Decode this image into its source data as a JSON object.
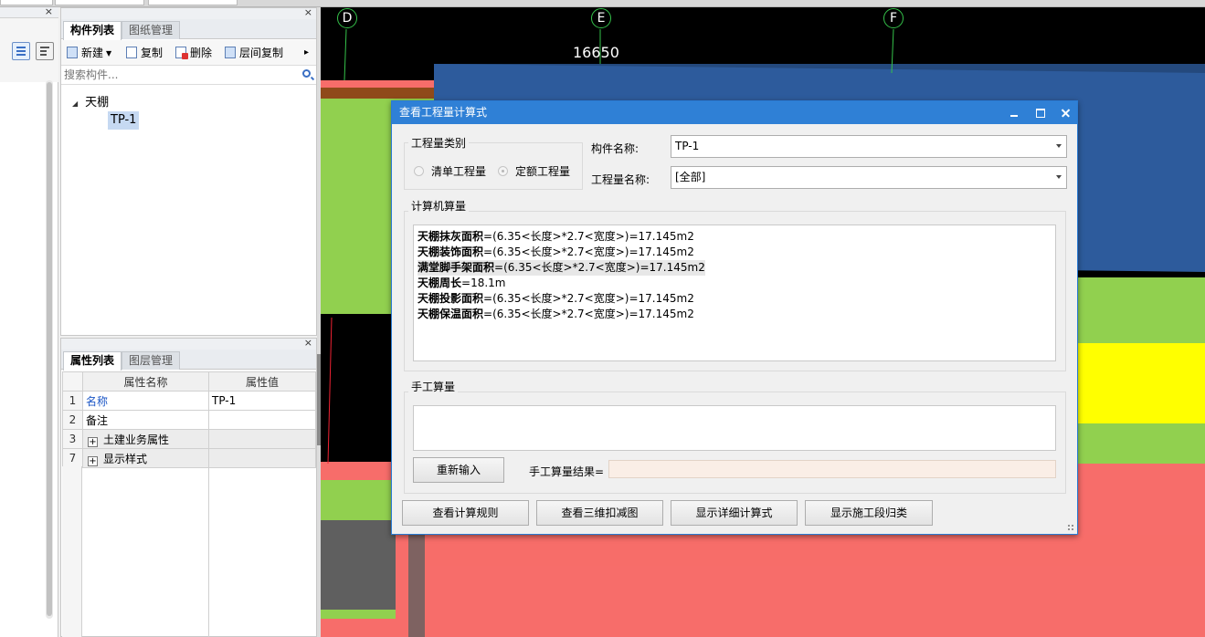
{
  "component_panel": {
    "tabs": [
      "构件列表",
      "图纸管理"
    ],
    "toolbar": {
      "new": "新建",
      "copy": "复制",
      "delete": "删除",
      "floor_copy": "层间复制",
      "more": "▸"
    },
    "search_placeholder": "搜索构件...",
    "tree": {
      "root": "天棚",
      "selected": "TP-1"
    },
    "close": "×"
  },
  "property_panel": {
    "tabs": [
      "属性列表",
      "图层管理"
    ],
    "columns": [
      "属性名称",
      "属性值"
    ],
    "rows": [
      {
        "num": "1",
        "name": "名称",
        "value": "TP-1"
      },
      {
        "num": "2",
        "name": "备注",
        "value": ""
      },
      {
        "num": "3",
        "name": "土建业务属性",
        "value": "",
        "expand": "+"
      },
      {
        "num": "7",
        "name": "显示样式",
        "value": "",
        "expand": "+"
      }
    ],
    "close": "×"
  },
  "left_panel": {
    "close": "×"
  },
  "canvas": {
    "axes": [
      "D",
      "E",
      "F"
    ],
    "dimension": "16650",
    "colors": {
      "background": "#000000",
      "green": "#91d04f",
      "blue": "#2d5b9c",
      "yellow": "#ffff00",
      "red": "#f76d6a",
      "gray": "#5f5f5f",
      "brown": "#8f4a1a"
    }
  },
  "dialog": {
    "title": "查看工程量计算式",
    "controls": {
      "minimize": "",
      "maximize": "",
      "close": ""
    },
    "quantity_type": {
      "label": "工程量类别",
      "option1": "清单工程量",
      "option2": "定额工程量",
      "selected": "定额工程量"
    },
    "component_name": {
      "label": "构件名称:",
      "value": "TP-1"
    },
    "quantity_name": {
      "label": "工程量名称:",
      "value": "[全部]"
    },
    "computer_calc": {
      "label": "计算机算量",
      "lines": [
        {
          "name": "天棚抹灰面积",
          "expr": "=(6.35<长度>*2.7<宽度>)=17.145m2"
        },
        {
          "name": "天棚装饰面积",
          "expr": "=(6.35<长度>*2.7<宽度>)=17.145m2"
        },
        {
          "name": "满堂脚手架面积",
          "expr": "=(6.35<长度>*2.7<宽度>)=17.145m2"
        },
        {
          "name": "天棚周长",
          "expr": "=18.1m"
        },
        {
          "name": "天棚投影面积",
          "expr": "=(6.35<长度>*2.7<宽度>)=17.145m2"
        },
        {
          "name": "天棚保温面积",
          "expr": "=(6.35<长度>*2.7<宽度>)=17.145m2"
        }
      ]
    },
    "manual_calc": {
      "label": "手工算量",
      "reenter": "重新输入",
      "result_label": "手工算量结果=",
      "result_value": ""
    },
    "buttons": {
      "rules": "查看计算规则",
      "view3d": "查看三维扣减图",
      "detail": "显示详细计算式",
      "stage": "显示施工段归类"
    }
  }
}
